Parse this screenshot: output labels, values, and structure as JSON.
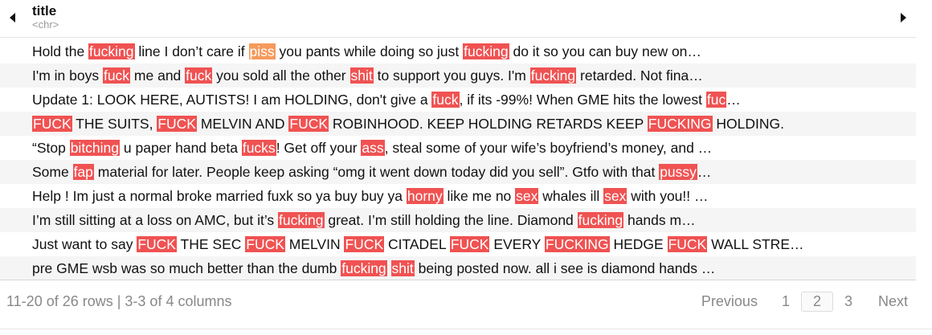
{
  "header": {
    "column_name": "title",
    "column_type": "<chr>",
    "left_arrow_icon": "triangle-left-icon",
    "right_arrow_icon": "triangle-right-icon"
  },
  "colors": {
    "highlight_red": "#f05252",
    "highlight_orange": "#f59a5c",
    "stripe": "#f5f5f5"
  },
  "rows": [
    [
      {
        "t": "Hold the "
      },
      {
        "t": "fucking",
        "h": "red"
      },
      {
        "t": " line I don’t care if "
      },
      {
        "t": "piss",
        "h": "orange"
      },
      {
        "t": " you pants while doing so just "
      },
      {
        "t": "fucking",
        "h": "red"
      },
      {
        "t": " do it so you can buy new on…"
      }
    ],
    [
      {
        "t": "I'm in boys "
      },
      {
        "t": "fuck",
        "h": "red"
      },
      {
        "t": " me and "
      },
      {
        "t": "fuck",
        "h": "red"
      },
      {
        "t": " you sold all the other "
      },
      {
        "t": "shit",
        "h": "red"
      },
      {
        "t": " to support you guys. I'm "
      },
      {
        "t": "fucking",
        "h": "red"
      },
      {
        "t": " retarded. Not fina…"
      }
    ],
    [
      {
        "t": "Update 1: LOOK HERE, AUTISTS! I am HOLDING, don't give a "
      },
      {
        "t": "fuck",
        "h": "red"
      },
      {
        "t": ", if its -99%! When GME hits the lowest "
      },
      {
        "t": "fuc",
        "h": "red"
      },
      {
        "t": "…"
      }
    ],
    [
      {
        "t": "FUCK",
        "h": "red"
      },
      {
        "t": " THE SUITS, "
      },
      {
        "t": "FUCK",
        "h": "red"
      },
      {
        "t": " MELVIN AND "
      },
      {
        "t": "FUCK",
        "h": "red"
      },
      {
        "t": " ROBINHOOD. KEEP HOLDING RETARDS KEEP "
      },
      {
        "t": "FUCKING",
        "h": "red"
      },
      {
        "t": " HOLDING."
      }
    ],
    [
      {
        "t": "“Stop "
      },
      {
        "t": "bitching",
        "h": "red"
      },
      {
        "t": " u paper hand beta "
      },
      {
        "t": "fucks",
        "h": "red"
      },
      {
        "t": "! Get off your "
      },
      {
        "t": "ass",
        "h": "red"
      },
      {
        "t": ", steal some of your wife’s boyfriend’s money, and …"
      }
    ],
    [
      {
        "t": "Some "
      },
      {
        "t": "fap",
        "h": "red"
      },
      {
        "t": " material for later. People keep asking “omg it went down today did you sell”. Gtfo with that "
      },
      {
        "t": "pussy",
        "h": "red"
      },
      {
        "t": "…"
      }
    ],
    [
      {
        "t": "Help ! Im just a normal broke married fuxk so ya buy buy ya "
      },
      {
        "t": "horny",
        "h": "red"
      },
      {
        "t": " like me no "
      },
      {
        "t": "sex",
        "h": "red"
      },
      {
        "t": " whales ill "
      },
      {
        "t": "sex",
        "h": "red"
      },
      {
        "t": " with you!! …"
      }
    ],
    [
      {
        "t": "I’m still sitting at a loss on AMC, but it’s "
      },
      {
        "t": "fucking",
        "h": "red"
      },
      {
        "t": " great. I’m still holding the line. Diamond "
      },
      {
        "t": "fucking",
        "h": "red"
      },
      {
        "t": " hands m…"
      }
    ],
    [
      {
        "t": "Just want to say "
      },
      {
        "t": "FUCK",
        "h": "red"
      },
      {
        "t": " THE SEC "
      },
      {
        "t": "FUCK",
        "h": "red"
      },
      {
        "t": " MELVIN "
      },
      {
        "t": "FUCK",
        "h": "red"
      },
      {
        "t": " CITADEL "
      },
      {
        "t": "FUCK",
        "h": "red"
      },
      {
        "t": " EVERY "
      },
      {
        "t": "FUCKING",
        "h": "red"
      },
      {
        "t": " HEDGE "
      },
      {
        "t": "FUCK",
        "h": "red"
      },
      {
        "t": " WALL STRE…"
      }
    ],
    [
      {
        "t": "pre GME wsb was so much better than the dumb "
      },
      {
        "t": "fucking",
        "h": "red"
      },
      {
        "t": " "
      },
      {
        "t": "shit",
        "h": "red"
      },
      {
        "t": " being posted now. all i see is diamond hands …"
      }
    ]
  ],
  "footer": {
    "rows_info": "11-20 of 26 rows | 3-3 of 4 columns",
    "previous_label": "Previous",
    "pages": [
      "1",
      "2",
      "3"
    ],
    "active_page": "2",
    "next_label": "Next"
  }
}
